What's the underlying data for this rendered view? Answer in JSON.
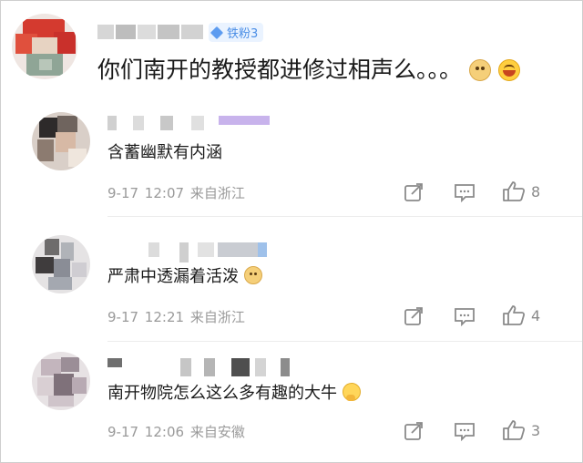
{
  "post": {
    "badge_label": "铁粉3",
    "text": "你们南开的教授都进修过相声么。。。",
    "emojis": [
      "doge-emoji",
      "laugh-emoji"
    ]
  },
  "comments": [
    {
      "text": "含蓄幽默有内涵",
      "emoji": "",
      "time": "9-17 12:07",
      "location": "来自浙江",
      "likes": "8"
    },
    {
      "text": "严肃中透漏着活泼",
      "emoji": "doge-emoji",
      "time": "9-17 12:21",
      "location": "来自浙江",
      "likes": "4"
    },
    {
      "text": "南开物院怎么这么多有趣的大牛",
      "emoji": "think-emoji",
      "time": "9-17 12:06",
      "location": "来自安徽",
      "likes": "3"
    }
  ],
  "colors": {
    "badge_bg": "#eaf3ff",
    "badge_text": "#4b8ee6",
    "meta": "#9a9a9a",
    "icon": "#8a8a8a"
  }
}
